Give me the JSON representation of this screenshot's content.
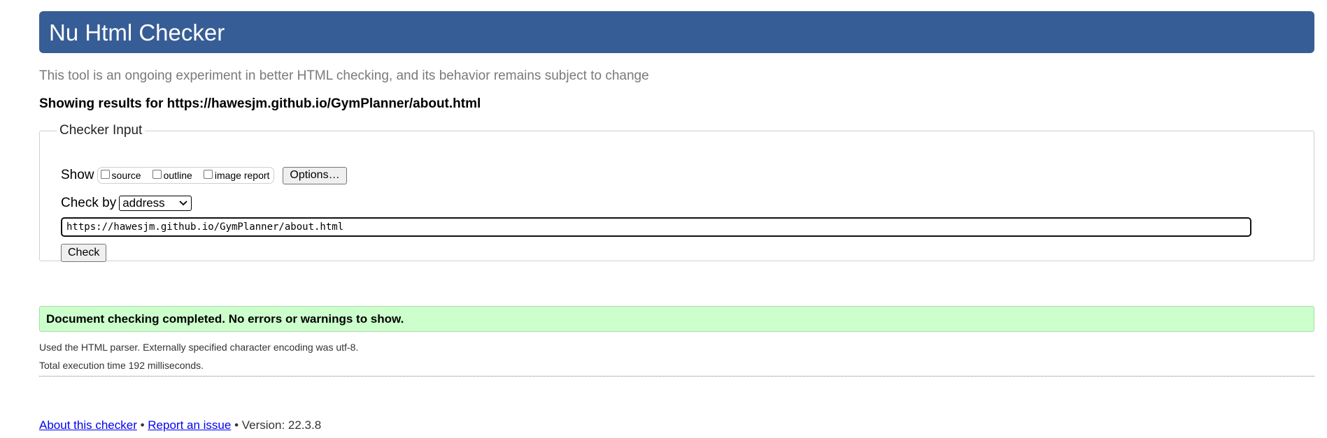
{
  "header": {
    "title": "Nu Html Checker"
  },
  "intro_text": "This tool is an ongoing experiment in better HTML checking, and its behavior remains subject to change",
  "results_heading": "Showing results for https://hawesjm.github.io/GymPlanner/about.html",
  "checker_input": {
    "legend": "Checker Input",
    "show_label": "Show",
    "show_options": [
      {
        "label": "source",
        "checked": false
      },
      {
        "label": "outline",
        "checked": false
      },
      {
        "label": "image report",
        "checked": false
      }
    ],
    "options_button": "Options…",
    "check_by_label": "Check by",
    "check_by_selected": "address",
    "url_value": "https://hawesjm.github.io/GymPlanner/about.html",
    "check_button": "Check"
  },
  "result": {
    "success_message": "Document checking completed. No errors or warnings to show.",
    "parser_note": "Used the HTML parser. Externally specified character encoding was utf-8.",
    "execution_time": "Total execution time 192 milliseconds."
  },
  "footer": {
    "about_link": "About this checker",
    "separator_1": " • ",
    "report_link": "Report an issue",
    "version_text": " • Version: 22.3.8"
  },
  "colors": {
    "header_bg": "#365d95",
    "success_bg": "#ccffcc",
    "link": "#0000ee"
  }
}
